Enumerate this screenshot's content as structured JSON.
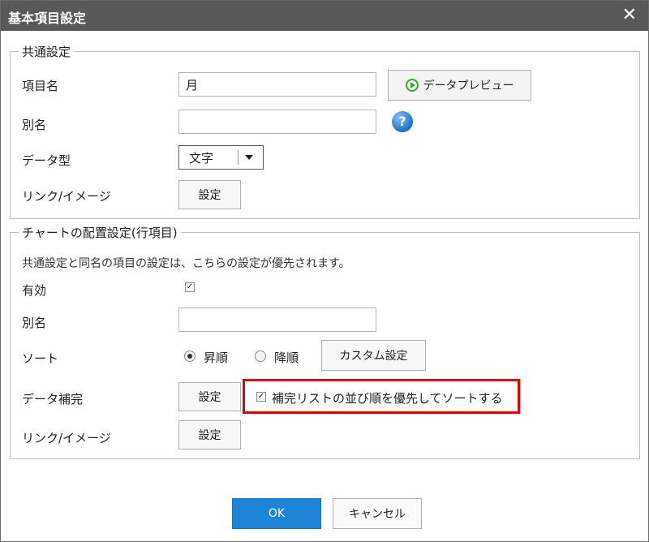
{
  "dialog": {
    "title": "基本項目設定",
    "close_symbol": "✕"
  },
  "common": {
    "legend": "共通設定",
    "item_name_label": "項目名",
    "item_name_value": "月",
    "preview_button": "データプレビュー",
    "alias_label": "別名",
    "alias_value": "",
    "help_symbol": "?",
    "datatype_label": "データ型",
    "datatype_value": "文字",
    "link_label": "リンク/イメージ",
    "link_button": "設定"
  },
  "chart": {
    "legend": "チャートの配置設定(行項目)",
    "note": "共通設定と同名の項目の設定は、こちらの設定が優先されます。",
    "enabled_label": "有効",
    "enabled_checked": true,
    "alias_label": "別名",
    "alias_value": "",
    "sort_label": "ソート",
    "sort_asc": "昇順",
    "sort_desc": "降順",
    "sort_selected": "asc",
    "custom_button": "カスタム設定",
    "complement_label": "データ補完",
    "complement_button": "設定",
    "complement_option": "補完リストの並び順を優先してソートする",
    "complement_option_checked": true,
    "link_label": "リンク/イメージ",
    "link_button": "設定"
  },
  "footer": {
    "ok": "OK",
    "cancel": "キャンセル"
  },
  "colors": {
    "titlebar": "#595959",
    "accent": "#1e84d8",
    "highlight": "#e00000"
  }
}
